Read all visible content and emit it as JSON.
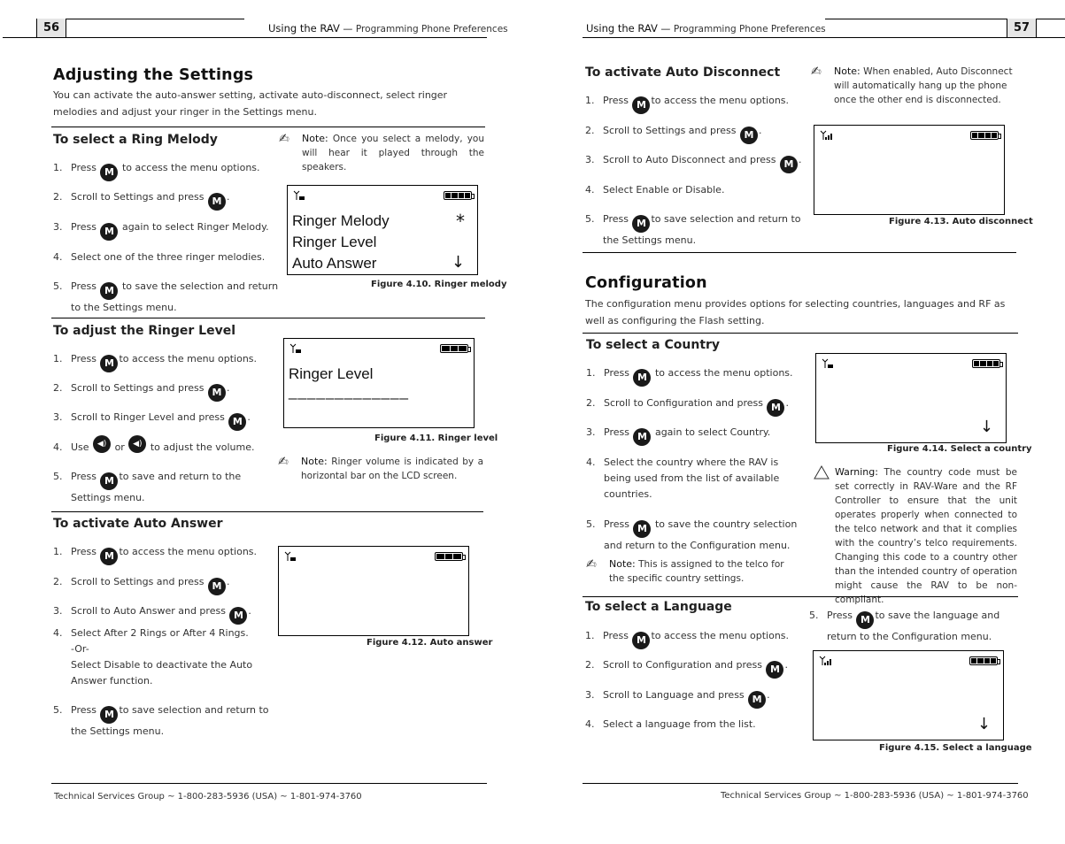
{
  "left_page": {
    "page_number": "56",
    "running_head": {
      "title": "Using the RAV",
      "sep": " — ",
      "subtitle": "Programming Phone Preferences"
    },
    "title": "Adjusting the Settings",
    "intro": "You can activate the auto-answer setting, activate auto-disconnect, select ringer melodies and adjust your ringer in the Settings menu.",
    "ring_melody": {
      "heading": "To select a Ring Melody",
      "steps": [
        {
          "n": "1.",
          "pre": "Press",
          "post": "to access the menu options."
        },
        {
          "n": "2.",
          "pre": "Scroll to Settings and press",
          "post": "."
        },
        {
          "n": "3.",
          "pre": "Press",
          "post": "again to select Ringer Melody."
        },
        {
          "n": "4.",
          "text": "Select one of the three ringer melodies."
        },
        {
          "n": "5.",
          "pre": "Press",
          "post": "to save the selection and return",
          "cont": "to the Settings menu."
        }
      ],
      "note_label": "Note:",
      "note_text": "Once you select a melody, you will hear it played through the speakers.",
      "lcd_lines": [
        "Ringer Melody",
        "Ringer Level",
        "Auto Answer"
      ],
      "lcd_marker": "*",
      "lcd_arrow": "↓",
      "caption": "Figure 4.10. Ringer melody"
    },
    "ringer_level": {
      "heading": "To adjust the Ringer Level",
      "steps": [
        {
          "n": "1.",
          "pre": "Press",
          "post": "to access the menu options."
        },
        {
          "n": "2.",
          "pre": "Scroll to Settings and press",
          "post": "."
        },
        {
          "n": "3.",
          "pre": "Scroll to Ringer Level and press",
          "post": "."
        },
        {
          "n": "4.",
          "pre": "Use",
          "mid": "or",
          "post": "to adjust the volume."
        },
        {
          "n": "5.",
          "pre": "Press",
          "post": "to save and return to the",
          "cont": "Settings menu."
        }
      ],
      "lcd_title": "Ringer Level",
      "lcd_bar": "_____________",
      "caption": "Figure 4.11. Ringer level",
      "note_label": "Note:",
      "note_text": "Ringer volume is indicated by a horizontal bar on the LCD screen."
    },
    "auto_answer": {
      "heading": "To activate Auto Answer",
      "steps": [
        {
          "n": "1.",
          "pre": "Press",
          "post": "to access the menu options."
        },
        {
          "n": "2.",
          "pre": "Scroll to Settings and press",
          "post": "."
        },
        {
          "n": "3.",
          "pre": "Scroll to Auto Answer and press",
          "post": "."
        },
        {
          "n": "4.",
          "text": "Select After 2 Rings or After 4 Rings.",
          "cont1": "-Or-",
          "cont2": "Select Disable to deactivate the Auto",
          "cont3": "Answer function."
        },
        {
          "n": "5.",
          "pre": "Press",
          "post": "to save selection and return to",
          "cont": "the Settings menu."
        }
      ],
      "caption": "Figure 4.12. Auto answer"
    },
    "footer": "Technical Services Group ~ 1-800-283-5936 (USA) ~ 1-801-974-3760"
  },
  "right_page": {
    "page_number": "57",
    "running_head": {
      "title": "Using the RAV",
      "sep": " — ",
      "subtitle": "Programming Phone Preferences"
    },
    "auto_disconnect": {
      "heading": "To activate Auto Disconnect",
      "steps": [
        {
          "n": "1.",
          "pre": "Press",
          "post": "to access the menu options."
        },
        {
          "n": "2.",
          "pre": "Scroll to Settings and press",
          "post": "."
        },
        {
          "n": "3.",
          "pre": "Scroll to Auto Disconnect and press",
          "post": "."
        },
        {
          "n": "4.",
          "text": "Select Enable or Disable."
        },
        {
          "n": "5.",
          "pre": "Press",
          "post": "to save selection and return to",
          "cont": "the Settings menu."
        }
      ],
      "note_label": "Note:",
      "note_text": "When enabled, Auto Disconnect will automatically hang up the phone once the other end is disconnected.",
      "caption": "Figure 4.13. Auto disconnect"
    },
    "configuration": {
      "title": "Configuration",
      "intro": "The configuration menu provides options for selecting countries, languages and RF as well as configuring the Flash setting."
    },
    "country": {
      "heading": "To select a Country",
      "steps": [
        {
          "n": "1.",
          "pre": "Press",
          "post": "to access the menu options."
        },
        {
          "n": "2.",
          "pre": "Scroll to Configuration and press",
          "post": "."
        },
        {
          "n": "3.",
          "pre": "Press",
          "post": "again to select Country."
        },
        {
          "n": "4.",
          "text": "Select the country where the RAV is",
          "cont1": "being used from the list of available",
          "cont2": "countries."
        },
        {
          "n": "5.",
          "pre": "Press",
          "post": "to save the country selection",
          "cont": "and return to the Configuration menu."
        }
      ],
      "note_label": "Note:",
      "note_text": "This is assigned to the telco for the specific country settings.",
      "lcd_arrow": "↓",
      "caption": "Figure 4.14. Select a country",
      "warning_label": "Warning:",
      "warning_text": "The country code must be set correctly in RAV-Ware and the RF Controller to ensure that the unit operates properly when connected to the telco network and that it complies with the country’s telco requirements. Changing this code to a country other than the intended country of operation might cause the RAV to be non-compliant."
    },
    "language": {
      "heading": "To select a Language",
      "steps": [
        {
          "n": "1.",
          "pre": "Press",
          "post": "to access the menu options."
        },
        {
          "n": "2.",
          "pre": "Scroll to Configuration and press",
          "post": "."
        },
        {
          "n": "3.",
          "pre": "Scroll to Language and press",
          "post": "."
        },
        {
          "n": "4.",
          "text": "Select a language from the list."
        },
        {
          "n": "5.",
          "pre": "Press",
          "post": "to save the language and",
          "cont": "return to the Configuration menu."
        }
      ],
      "lcd_arrow": "↓",
      "caption": "Figure 4.15. Select a language"
    },
    "footer": "Technical Services Group ~ 1-800-283-5936 (USA) ~ 1-801-974-3760"
  },
  "icons": {
    "menu_button": "M",
    "vol_up": "◀)",
    "vol_down": "◀)"
  }
}
